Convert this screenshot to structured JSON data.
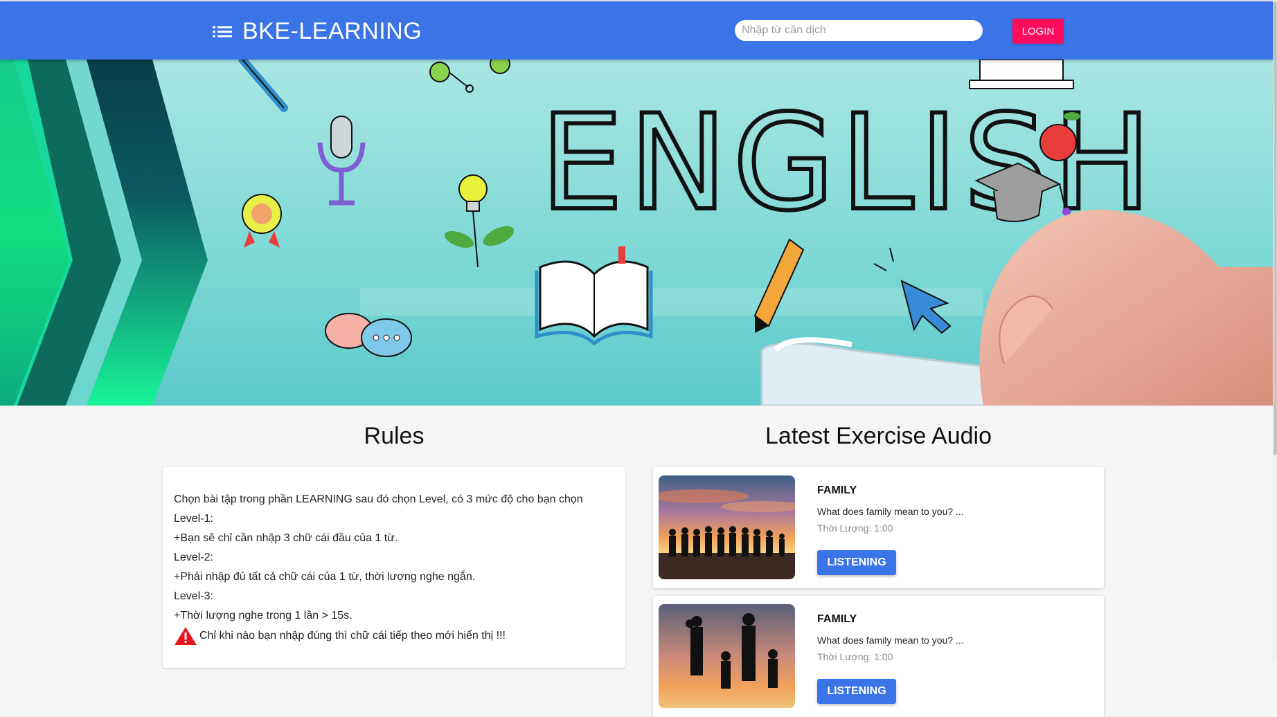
{
  "header": {
    "brand": "BKE-LEARNING",
    "search_placeholder": "Nhập từ cần dịch",
    "login_label": "LOGIN",
    "color": "#3a74e6",
    "login_color": "#ff0d5c"
  },
  "hero": {
    "banner_text": "ENGLISH"
  },
  "rules": {
    "title": "Rules",
    "lines": [
      "Chọn bài tập trong phần LEARNING sau đó chọn Level, có 3 mức độ cho bạn chọn",
      "Level-1:",
      "+Bạn sẽ chỉ cần nhập 3 chữ cái đầu của 1 từ.",
      "Level-2:",
      "+Phải nhập đủ tất cả chữ cái của 1 từ, thời lượng nghe ngắn.",
      "Level-3:",
      "+Thời lượng nghe trong 1 lần > 15s."
    ],
    "warning": "Chỉ khi nào bạn nhập đúng thì chữ cái tiếp theo mới hiển thị !!!"
  },
  "latest": {
    "title": "Latest Exercise Audio",
    "items": [
      {
        "title": "FAMILY",
        "description": "What does family mean to you? ...",
        "duration": "Thời Lượng: 1:00",
        "button": "LISTENING"
      },
      {
        "title": "FAMILY",
        "description": "What does family mean to you? ...",
        "duration": "Thời Lượng: 1:00",
        "button": "LISTENING"
      }
    ]
  }
}
